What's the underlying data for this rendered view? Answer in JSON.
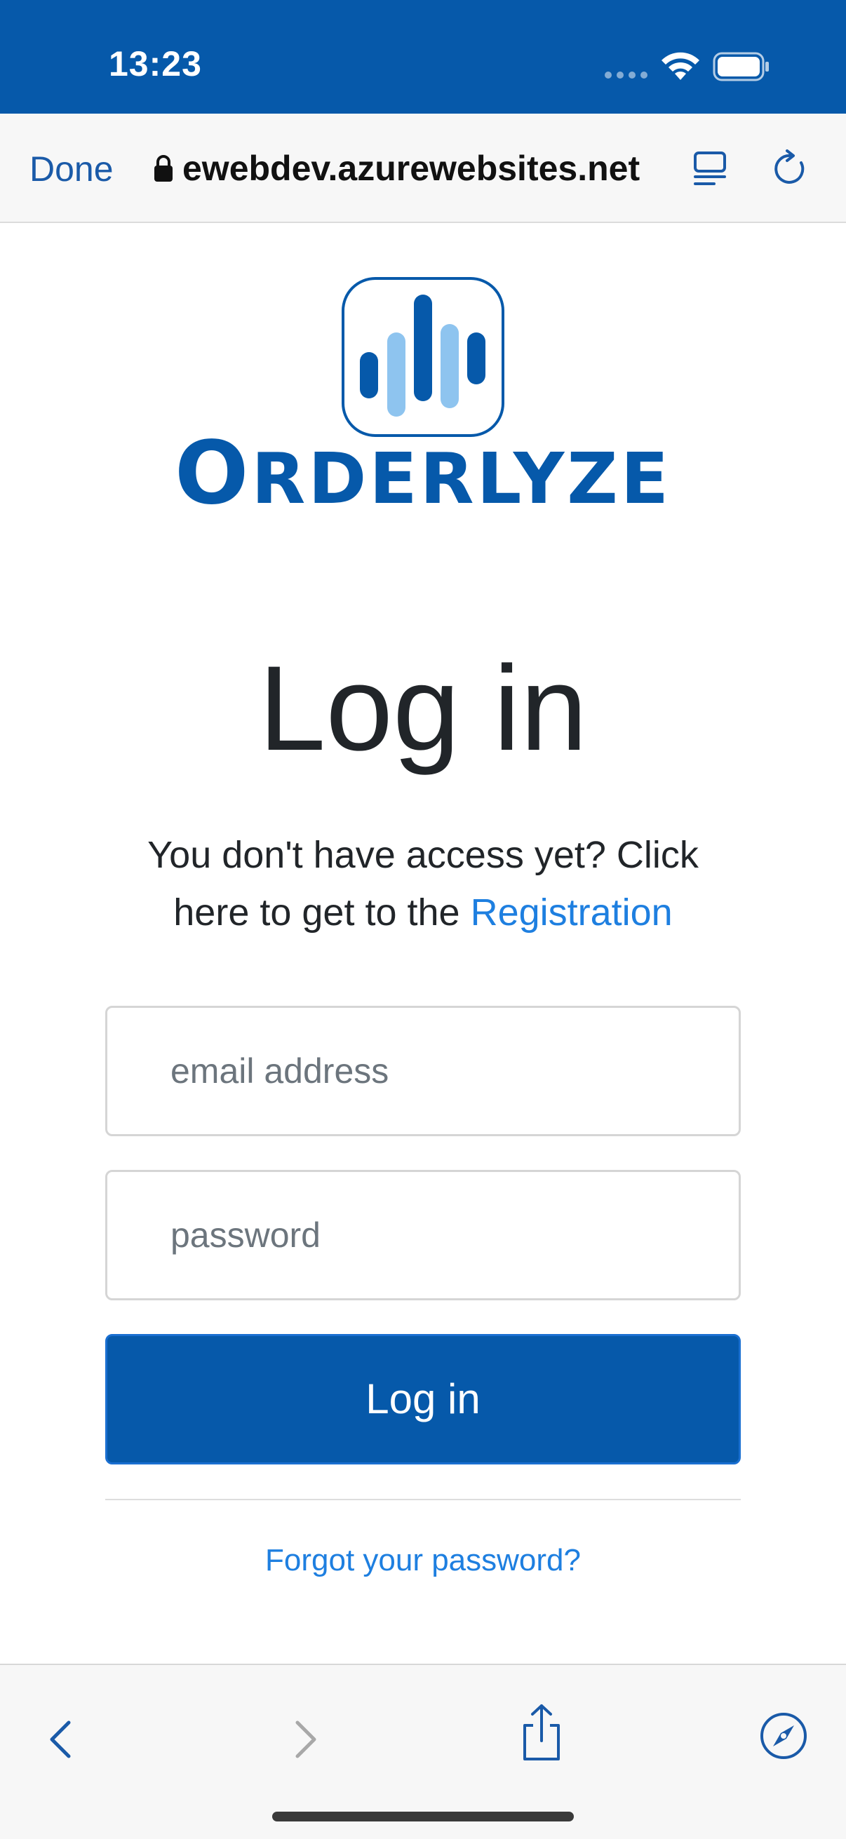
{
  "status_bar": {
    "time": "13:23"
  },
  "browser": {
    "done_label": "Done",
    "url": "ewebdev.azurewebsites.net"
  },
  "brand": {
    "name": "ORDERLYZE",
    "name_first": "O",
    "name_rest": "RDERLYZE",
    "color": "#0659aa",
    "accent_light": "#8ec4ef"
  },
  "login": {
    "title": "Log in",
    "registration_text": "You don't have access yet? Click here to get to the",
    "registration_link": "Registration",
    "email_placeholder": "email address",
    "password_placeholder": "password",
    "button_label": "Log in",
    "forgot_link": "Forgot your password?"
  },
  "icons": {
    "back": "chevron-left-icon",
    "forward": "chevron-right-icon",
    "share": "share-icon",
    "compass": "compass-icon",
    "reader": "reader-icon",
    "reload": "reload-icon"
  }
}
